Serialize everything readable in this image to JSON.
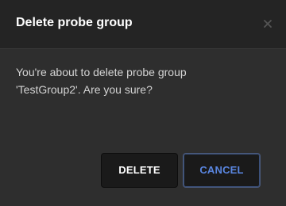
{
  "dialog": {
    "title": "Delete probe group",
    "close_icon": "close-icon",
    "message": "You're about to delete probe group 'TestGroup2'. Are you sure?",
    "buttons": {
      "delete_label": "DELETE",
      "cancel_label": "CANCEL"
    }
  },
  "colors": {
    "header_background": "#242424",
    "body_background": "#2e2e2e",
    "title_text": "#ffffff",
    "message_text": "#d4d4d4",
    "button_background": "#1a1a1a",
    "cancel_text": "#5a86e0"
  }
}
